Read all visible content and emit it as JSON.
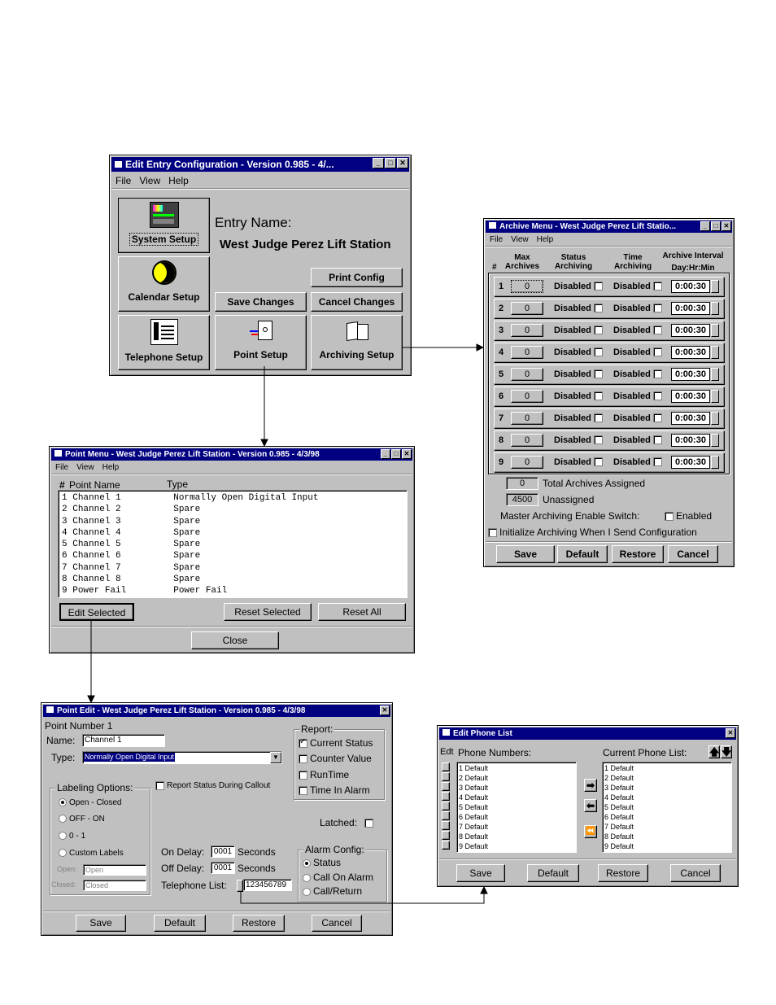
{
  "entry_window": {
    "title": "Edit Entry Configuration - Version 0.985 - 4/...",
    "menu": [
      "File",
      "View",
      "Help"
    ],
    "entry_name_label": "Entry Name:",
    "entry_name": "West Judge Perez Lift Station",
    "buttons": {
      "system_setup": "System Setup",
      "calendar_setup": "Calendar Setup",
      "telephone_setup": "Telephone Setup",
      "point_setup": "Point Setup",
      "archiving_setup": "Archiving Setup",
      "print_config": "Print Config",
      "save_changes": "Save Changes",
      "cancel_changes": "Cancel Changes"
    }
  },
  "archive_window": {
    "title": "Archive Menu - West Judge Perez Lift Statio...",
    "menu": [
      "File",
      "View",
      "Help"
    ],
    "headers": {
      "num": "#",
      "max": "Max Archives",
      "status": "Status Archiving",
      "time": "Time Archiving",
      "interval": "Archive Interval Day:Hr:Min"
    },
    "rows": [
      {
        "num": "1",
        "max": "0",
        "status": "Disabled",
        "time": "Disabled",
        "interval": "0:00:30"
      },
      {
        "num": "2",
        "max": "0",
        "status": "Disabled",
        "time": "Disabled",
        "interval": "0:00:30"
      },
      {
        "num": "3",
        "max": "0",
        "status": "Disabled",
        "time": "Disabled",
        "interval": "0:00:30"
      },
      {
        "num": "4",
        "max": "0",
        "status": "Disabled",
        "time": "Disabled",
        "interval": "0:00:30"
      },
      {
        "num": "5",
        "max": "0",
        "status": "Disabled",
        "time": "Disabled",
        "interval": "0:00:30"
      },
      {
        "num": "6",
        "max": "0",
        "status": "Disabled",
        "time": "Disabled",
        "interval": "0:00:30"
      },
      {
        "num": "7",
        "max": "0",
        "status": "Disabled",
        "time": "Disabled",
        "interval": "0:00:30"
      },
      {
        "num": "8",
        "max": "0",
        "status": "Disabled",
        "time": "Disabled",
        "interval": "0:00:30"
      },
      {
        "num": "9",
        "max": "0",
        "status": "Disabled",
        "time": "Disabled",
        "interval": "0:00:30"
      }
    ],
    "total_value": "0",
    "total_label": "Total Archives Assigned",
    "unassigned_value": "4500",
    "unassigned_label": "Unassigned",
    "master_label": "Master Archiving Enable Switch:",
    "enabled_label": "Enabled",
    "init_label": "Initialize Archiving When I Send Configuration",
    "buttons": {
      "save": "Save",
      "default": "Default",
      "restore": "Restore",
      "cancel": "Cancel"
    }
  },
  "point_menu": {
    "title": "Point Menu - West Judge Perez Lift Station - Version 0.985 - 4/3/98",
    "menu": [
      "File",
      "View",
      "Help"
    ],
    "col_num": "#",
    "col_name": "Point Name",
    "col_type": "Type",
    "rows": [
      {
        "num": "1",
        "name": "Channel 1",
        "type": "Normally Open Digital Input"
      },
      {
        "num": "2",
        "name": "Channel 2",
        "type": "Spare"
      },
      {
        "num": "3",
        "name": "Channel 3",
        "type": "Spare"
      },
      {
        "num": "4",
        "name": "Channel 4",
        "type": "Spare"
      },
      {
        "num": "5",
        "name": "Channel 5",
        "type": "Spare"
      },
      {
        "num": "6",
        "name": "Channel 6",
        "type": "Spare"
      },
      {
        "num": "7",
        "name": "Channel 7",
        "type": "Spare"
      },
      {
        "num": "8",
        "name": "Channel 8",
        "type": "Spare"
      },
      {
        "num": "9",
        "name": "Power Fail",
        "type": "Power Fail"
      }
    ],
    "buttons": {
      "edit": "Edit Selected",
      "reset_selected": "Reset Selected",
      "reset_all": "Reset All",
      "close": "Close"
    }
  },
  "point_edit": {
    "title": "Point Edit - West Judge Perez Lift Station - Version 0.985 - 4/3/98",
    "point_number": "Point Number 1",
    "name_label": "Name:",
    "name_value": "Channel 1",
    "type_label": "Type:",
    "type_value": "Normally Open Digital Input",
    "labeling_title": "Labeling Options:",
    "labeling_options": [
      "Open - Closed",
      "OFF - ON",
      "0 - 1",
      "Custom Labels"
    ],
    "open_label": "Open:",
    "open_placeholder": "Open",
    "closed_label": "Closed:",
    "closed_placeholder": "Closed",
    "report_callout": "Report Status During Callout",
    "report_title": "Report:",
    "report_options": [
      "Current Status",
      "Counter Value",
      "RunTime",
      "Time In Alarm"
    ],
    "latched_label": "Latched:",
    "on_delay_label": "On Delay:",
    "on_delay_value": "0001",
    "off_delay_label": "Off Delay:",
    "off_delay_value": "0001",
    "seconds": "Seconds",
    "telephone_label": "Telephone List:",
    "telephone_value": "123456789",
    "alarm_title": "Alarm Config:",
    "alarm_options": [
      "Status",
      "Call On Alarm",
      "Call/Return"
    ],
    "buttons": {
      "save": "Save",
      "default": "Default",
      "restore": "Restore",
      "cancel": "Cancel"
    }
  },
  "phone_list": {
    "title": "Edit Phone List",
    "edit_label": "Edt",
    "phone_numbers_label": "Phone Numbers:",
    "current_list_label": "Current Phone List:",
    "phone_numbers": [
      "1 Default",
      "2 Default",
      "3 Default",
      "4 Default",
      "5 Default",
      "6 Default",
      "7 Default",
      "8 Default",
      "9 Default"
    ],
    "current_list": [
      "1 Default",
      "2 Default",
      "3 Default",
      "4 Default",
      "5 Default",
      "6 Default",
      "7 Default",
      "8 Default",
      "9 Default"
    ],
    "buttons": {
      "save": "Save",
      "default": "Default",
      "restore": "Restore",
      "cancel": "Cancel"
    }
  }
}
